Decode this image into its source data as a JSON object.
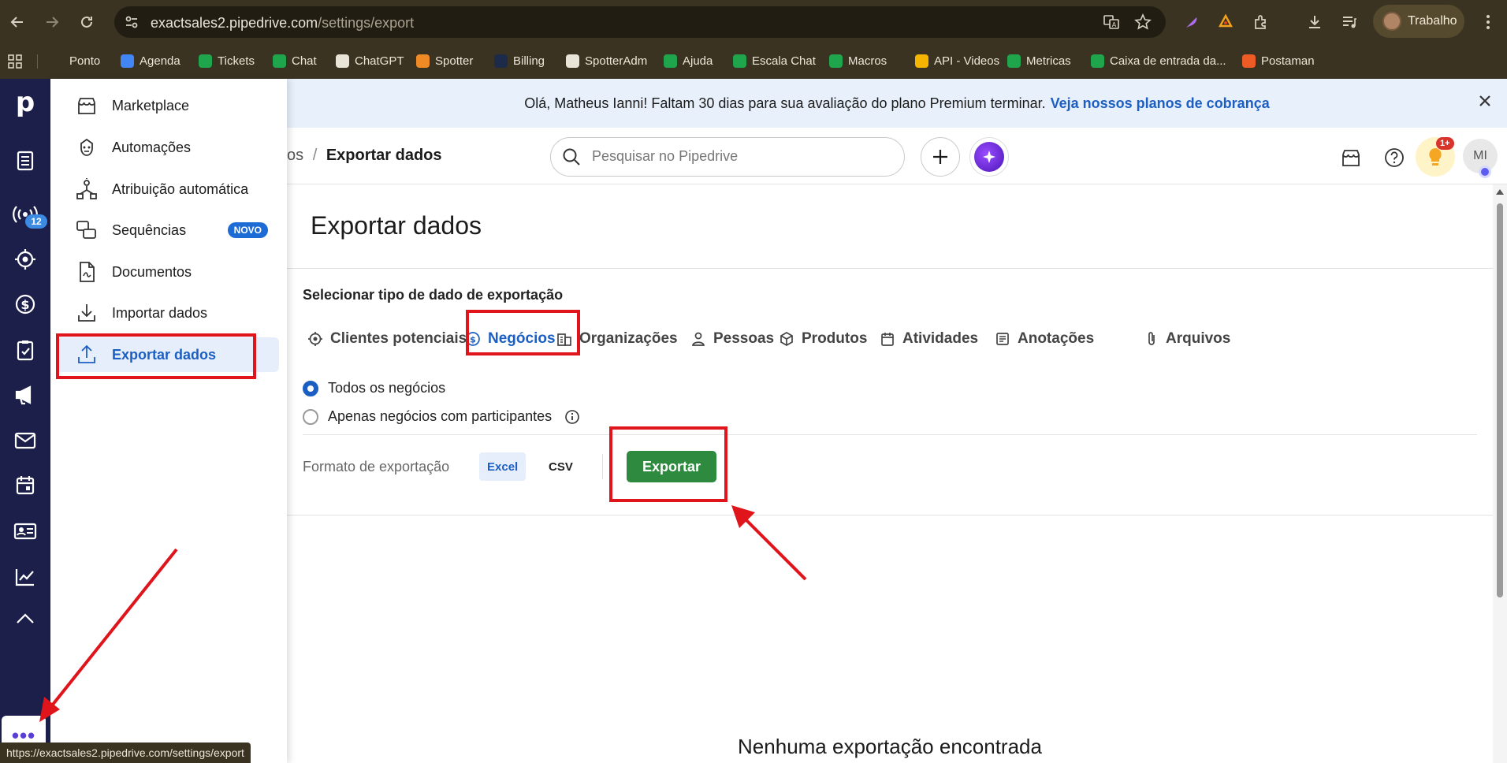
{
  "browser": {
    "url_host": "exactsales2.pipedrive.com",
    "url_path": "/settings/export",
    "profile_label": "Trabalho"
  },
  "bookmarks": [
    {
      "label": "Ponto",
      "icon": "ponto-icon",
      "color": "#3b3322"
    },
    {
      "label": "Agenda",
      "icon": "calendar-icon",
      "color": "#4285f4"
    },
    {
      "label": "Tickets",
      "icon": "headset-icon",
      "color": "#1fa54b"
    },
    {
      "label": "Chat",
      "icon": "chat-icon",
      "color": "#1fa54b"
    },
    {
      "label": "ChatGPT",
      "icon": "openai-icon",
      "color": "#e9e4d8"
    },
    {
      "label": "Spotter",
      "icon": "spotter-icon",
      "color": "#f08a24"
    },
    {
      "label": "Billing",
      "icon": "billing-icon",
      "color": "#1c2b4a"
    },
    {
      "label": "SpotterAdm",
      "icon": "doc-icon",
      "color": "#e9e4d8"
    },
    {
      "label": "Ajuda",
      "icon": "headset-icon",
      "color": "#1fa54b"
    },
    {
      "label": "Escala Chat",
      "icon": "sheets-icon",
      "color": "#1fa54b"
    },
    {
      "label": "Macros",
      "icon": "sheets-icon",
      "color": "#1fa54b"
    },
    {
      "label": "API - Videos",
      "icon": "drive-icon",
      "color": "#f4b400"
    },
    {
      "label": "Metricas",
      "icon": "headset-icon",
      "color": "#1fa54b"
    },
    {
      "label": "Caixa de entrada da...",
      "icon": "chat-icon",
      "color": "#1fa54b"
    },
    {
      "label": "Postaman",
      "icon": "postman-icon",
      "color": "#ef5b25"
    }
  ],
  "rail": {
    "logo": "p",
    "badge_count": "12",
    "more_label": "•••"
  },
  "flyout": {
    "items": [
      {
        "label": "Marketplace",
        "icon": "store-icon"
      },
      {
        "label": "Automações",
        "icon": "robot-icon"
      },
      {
        "label": "Atribuição automática",
        "icon": "assignment-icon"
      },
      {
        "label": "Sequências",
        "icon": "sequences-icon",
        "badge": "NOVO"
      },
      {
        "label": "Documentos",
        "icon": "document-icon"
      },
      {
        "label": "Importar dados",
        "icon": "import-icon"
      },
      {
        "label": "Exportar dados",
        "icon": "export-icon",
        "active": true
      }
    ]
  },
  "banner": {
    "text": "Olá, Matheus Ianni! Faltam 30 dias para sua avaliação do plano Premium terminar.",
    "link": "Veja nossos planos de cobrança"
  },
  "header": {
    "breadcrumb_parent": "os",
    "breadcrumb_sep": "/",
    "breadcrumb_current": "Exportar dados",
    "search_placeholder": "Pesquisar no Pipedrive",
    "tips_badge": "1+",
    "avatar_initials": "MI"
  },
  "content": {
    "title": "Exportar dados",
    "section_label": "Selecionar tipo de dado de exportação",
    "tabs": [
      {
        "label": "Clientes potenciais",
        "icon": "target-icon"
      },
      {
        "label": "Negócios",
        "icon": "dollar-icon",
        "active": true
      },
      {
        "label": "Organizações",
        "icon": "building-icon"
      },
      {
        "label": "Pessoas",
        "icon": "person-icon"
      },
      {
        "label": "Produtos",
        "icon": "box-icon"
      },
      {
        "label": "Atividades",
        "icon": "calendar-icon"
      },
      {
        "label": "Anotações",
        "icon": "note-icon"
      },
      {
        "label": "Arquivos",
        "icon": "paperclip-icon"
      }
    ],
    "radio_all": "Todos os negócios",
    "radio_participants": "Apenas negócios com participantes",
    "format_label": "Formato de exportação",
    "format_excel": "Excel",
    "format_csv": "CSV",
    "export_button": "Exportar",
    "empty_state": "Nenhuma exportação encontrada"
  },
  "status_url": "https://exactsales2.pipedrive.com/settings/export",
  "colors": {
    "accent": "#1c5fc3",
    "export_green": "#2d8a3e",
    "rail": "#1c1f4a",
    "annotation_red": "#e0141b"
  }
}
